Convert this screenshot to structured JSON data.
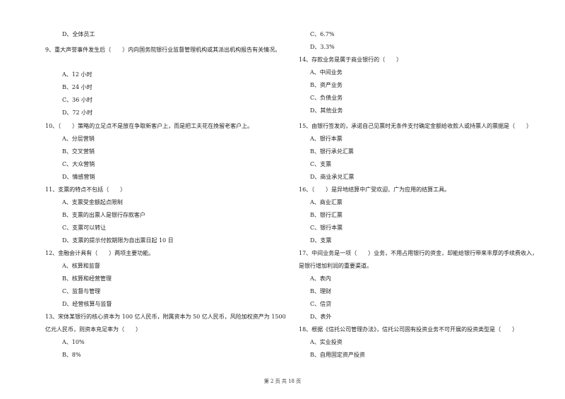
{
  "left_column": [
    {
      "type": "option",
      "text": "D、全体员工"
    },
    {
      "type": "question",
      "text": "9、重大声誉事件发生后（　　）内向国务院银行业监督管理机构或其派出机构报告有关情况。"
    },
    {
      "type": "option",
      "text": "A、12 小时"
    },
    {
      "type": "option",
      "text": "B、24 小时"
    },
    {
      "type": "option",
      "text": "C、36 小时"
    },
    {
      "type": "option",
      "text": "D、72 小时"
    },
    {
      "type": "question",
      "text": "10、（　　）策略的立足点不是放在争取新客户上，而是把工夫花在挽留老客户上。"
    },
    {
      "type": "option",
      "text": "A、分层营销"
    },
    {
      "type": "option",
      "text": "B、交叉营销"
    },
    {
      "type": "option",
      "text": "C、大众营销"
    },
    {
      "type": "option",
      "text": "D、情感营销"
    },
    {
      "type": "question",
      "text": "11、支票的特点不包括（　　）"
    },
    {
      "type": "option",
      "text": "A、支票受金额起点限制"
    },
    {
      "type": "option",
      "text": "B、支票的出票人是银行存款客户"
    },
    {
      "type": "option",
      "text": "C、支票可以转让"
    },
    {
      "type": "option",
      "text": "D、支票的提示付款期限为自出票日起 10 日"
    },
    {
      "type": "question",
      "text": "12、金融会计具有（　　）两项主要功能。"
    },
    {
      "type": "option",
      "text": "A、核算和监督"
    },
    {
      "type": "option",
      "text": "B、核算和经营管理"
    },
    {
      "type": "option",
      "text": "C、监督与管理"
    },
    {
      "type": "option",
      "text": "D、经营核算与监督"
    },
    {
      "type": "question",
      "text": "13、宋体某银行的核心资本为 100 亿人民币，附属资本为 50 亿人民币，风险加权资产为 1500"
    },
    {
      "type": "continuation",
      "text": "亿元人民币，则资本充足率为（　　）"
    },
    {
      "type": "option",
      "text": "A、10%"
    },
    {
      "type": "option",
      "text": "B、8%"
    }
  ],
  "right_column": [
    {
      "type": "option",
      "text": "C、6.7%"
    },
    {
      "type": "option",
      "text": "D、3.3%"
    },
    {
      "type": "question",
      "text": "14、存款业务是属于商业银行的（　　）"
    },
    {
      "type": "option",
      "text": "A、中间业务"
    },
    {
      "type": "option",
      "text": "B、资产业务"
    },
    {
      "type": "option",
      "text": "C、负债业务"
    },
    {
      "type": "option",
      "text": "D、其他业务"
    },
    {
      "type": "question",
      "text": "15、由银行签发的，承诺自己见票时无条件支付确定金额给收款人或持票人的票据是（　　）"
    },
    {
      "type": "option",
      "text": "A、银行本票"
    },
    {
      "type": "option",
      "text": "B、银行承兑汇票"
    },
    {
      "type": "option",
      "text": "C、支票"
    },
    {
      "type": "option",
      "text": "D、商业承兑汇票"
    },
    {
      "type": "question",
      "text": "16、（　　）是异地结算中广受欢迎、广为应用的结算工具。"
    },
    {
      "type": "option",
      "text": "A、商业汇票"
    },
    {
      "type": "option",
      "text": "B、银行汇票"
    },
    {
      "type": "option",
      "text": "C、银行本票"
    },
    {
      "type": "option",
      "text": "D、支票"
    },
    {
      "type": "question",
      "text": "17、中间业务是一项（　　）业务，不用占用银行的资金，却能给银行带来丰厚的手续费收入，"
    },
    {
      "type": "continuation",
      "text": "是银行增加利润的重要渠道。"
    },
    {
      "type": "option",
      "text": "A、表内"
    },
    {
      "type": "option",
      "text": "B、理财"
    },
    {
      "type": "option",
      "text": "C、信贷"
    },
    {
      "type": "option",
      "text": "D、表外"
    },
    {
      "type": "question",
      "text": "18、根据《信托公司管理办法》，信托公司固有投资业务不可开展的投资类型是（　　）"
    },
    {
      "type": "option",
      "text": "A、实业投资"
    },
    {
      "type": "option",
      "text": "B、自用固定资产投资"
    }
  ],
  "footer": {
    "page_label": "第 2 页 共 18 页"
  }
}
